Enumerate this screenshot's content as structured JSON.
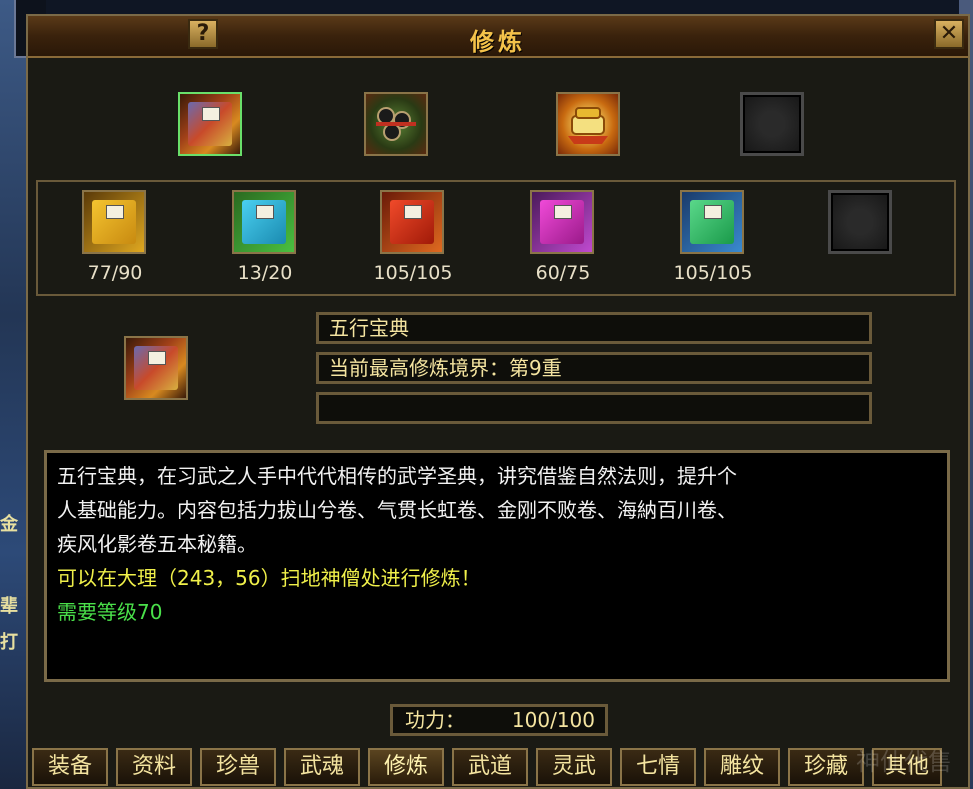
{
  "window": {
    "title": "修炼",
    "help_label": "?",
    "close_label": "✕"
  },
  "side_fragments": [
    "金",
    "辈",
    "打"
  ],
  "top_slots": [
    {
      "name": "五行宝典",
      "icon": "book-five-elements-icon",
      "selected": true
    },
    {
      "name": "scroll-bundle",
      "icon": "scroll-bundle-icon",
      "selected": false
    },
    {
      "name": "golden-treasure",
      "icon": "golden-treasure-icon",
      "selected": false
    },
    {
      "name": "empty",
      "icon": "empty-slot-icon",
      "selected": false
    }
  ],
  "books": [
    {
      "count": "77/90",
      "color": "#e0a820",
      "icon": "yellow-book-icon"
    },
    {
      "count": "13/20",
      "color": "#2aa8d8",
      "icon": "blue-book-icon"
    },
    {
      "count": "105/105",
      "color": "#d8401a",
      "icon": "red-book-icon"
    },
    {
      "count": "60/75",
      "color": "#d83ac0",
      "icon": "pink-book-icon"
    },
    {
      "count": "105/105",
      "color": "#3ac070",
      "icon": "green-book-icon"
    },
    {
      "count": "",
      "color": "",
      "icon": "empty-slot-icon"
    }
  ],
  "selected_info": {
    "name": "五行宝典",
    "level": "当前最高修炼境界：第9重",
    "extra": ""
  },
  "description": {
    "line1": "五行宝典，在习武之人手中代代相传的武学圣典，讲究借鉴自然法则，提升个",
    "line2": "人基础能力。内容包括力拔山兮卷、气贯长虹卷、金刚不败卷、海納百川卷、",
    "line3": "疾风化影卷五本秘籍。",
    "location": "可以在大理（243，56）扫地神僧处进行修炼！",
    "requirement": "需要等级70"
  },
  "gongli": {
    "label": "功力：",
    "value": "100/100"
  },
  "tabs": [
    "装备",
    "资料",
    "珍兽",
    "武魂",
    "修炼",
    "武道",
    "灵武",
    "七情",
    "雕纹",
    "珍藏",
    "其他"
  ],
  "active_tab": "修炼",
  "watermark": "神仙代售",
  "colors": {
    "title": "#f4c24a",
    "desc_white": "#f2f2f2",
    "desc_yellow": "#f0f04a",
    "desc_green": "#4ae04a",
    "border": "#8a7448"
  }
}
